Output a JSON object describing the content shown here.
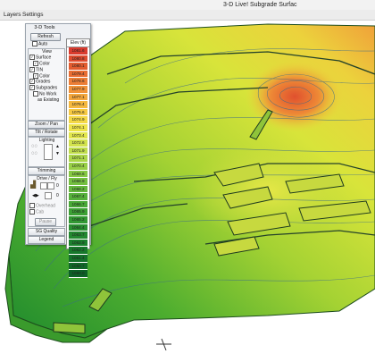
{
  "window": {
    "title": "3-D Live!   Subgrade Surfac"
  },
  "menu": [
    "Layers",
    "Settings"
  ],
  "tools": {
    "title": "3-D Tools",
    "refresh_label": "Refresh",
    "auto_label": "Auto",
    "view": {
      "header": "View",
      "surface": "Surface",
      "color1": "Color",
      "tin": "TIN",
      "color2": "Color",
      "grades": "Grades",
      "subgrades": "Subgrades",
      "no_work": "No Work",
      "as_existing": "as Existing"
    },
    "zoom_pan": "Zoom / Pan",
    "tilt_rotate": "Tilt / Rotate",
    "lighting": "Lighting",
    "trimming": "Trimming",
    "drive_fly": "Drive / Fly",
    "drive_value_1": "0",
    "drive_value_2": "0",
    "overhead": "Overhead",
    "cab": "Cab",
    "pause": "Pause",
    "sg_quality": "SG Quality",
    "legend_btn": "Legend"
  },
  "legend": {
    "header": "Elev (ft)",
    "entries": [
      {
        "value": "1081.6",
        "color": "#d93b2e"
      },
      {
        "value": "1080.8",
        "color": "#de4b2f"
      },
      {
        "value": "1080.1",
        "color": "#e25c30"
      },
      {
        "value": "1079.4",
        "color": "#e86d33"
      },
      {
        "value": "1078.6",
        "color": "#ec7e36"
      },
      {
        "value": "1077.9",
        "color": "#f09239"
      },
      {
        "value": "1077.1",
        "color": "#f3a63c"
      },
      {
        "value": "1076.4",
        "color": "#f5b83f"
      },
      {
        "value": "1075.6",
        "color": "#f6c942"
      },
      {
        "value": "1074.9",
        "color": "#f4d845"
      },
      {
        "value": "1074.1",
        "color": "#eee44a"
      },
      {
        "value": "1073.4",
        "color": "#e2e64c"
      },
      {
        "value": "1072.6",
        "color": "#d2e24c"
      },
      {
        "value": "1071.9",
        "color": "#c0dd4b"
      },
      {
        "value": "1071.1",
        "color": "#acd649"
      },
      {
        "value": "1070.4",
        "color": "#98cf46"
      },
      {
        "value": "1069.6",
        "color": "#85c843"
      },
      {
        "value": "1068.9",
        "color": "#74c040"
      },
      {
        "value": "1068.2",
        "color": "#64b83d"
      },
      {
        "value": "1067.4",
        "color": "#55b03a"
      },
      {
        "value": "1066.7",
        "color": "#48a837"
      },
      {
        "value": "1065.9",
        "color": "#3ca035"
      },
      {
        "value": "1065.2",
        "color": "#329833"
      },
      {
        "value": "1064.4",
        "color": "#2a9031"
      },
      {
        "value": "1063.7",
        "color": "#228830"
      },
      {
        "value": "1062.9",
        "color": "#1c802e"
      },
      {
        "value": "1062.2",
        "color": "#17782c"
      },
      {
        "value": "1061.4",
        "color": "#13702a"
      },
      {
        "value": "1060.7",
        "color": "#106828"
      },
      {
        "value": "1060.0",
        "color": "#0d6026"
      }
    ]
  }
}
